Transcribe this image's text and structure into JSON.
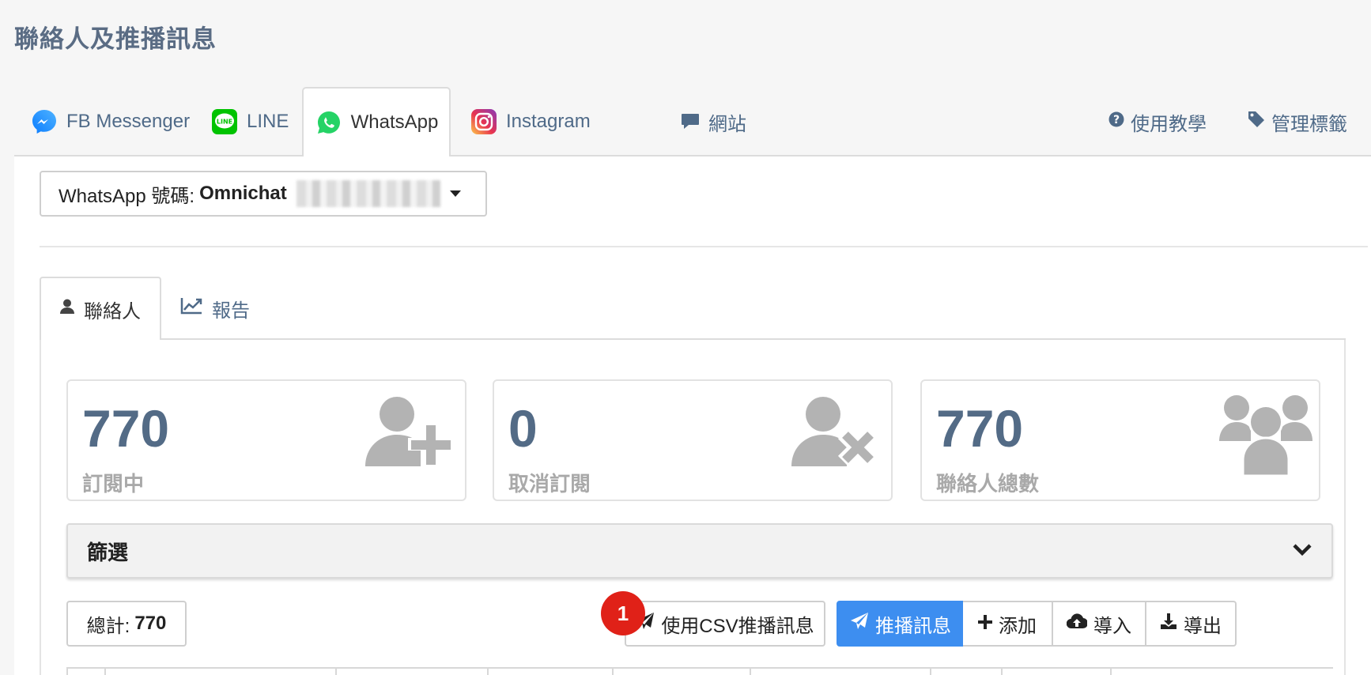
{
  "page": {
    "title": "聯絡人及推播訊息"
  },
  "top_tabs": [
    {
      "label": "FB Messenger",
      "icon": "messenger-icon"
    },
    {
      "label": "LINE",
      "icon": "line-icon"
    },
    {
      "label": "WhatsApp",
      "icon": "whatsapp-icon",
      "active": true
    },
    {
      "label": "Instagram",
      "icon": "instagram-icon"
    },
    {
      "label": "網站",
      "icon": "chat-bubble-icon"
    }
  ],
  "right_links": {
    "tutorial": "使用教學",
    "manage_tags": "管理標籤"
  },
  "whatsapp_select": {
    "prefix": "WhatsApp 號碼:",
    "name": "Omnichat"
  },
  "sub_tabs": {
    "contacts": "聯絡人",
    "report": "報告"
  },
  "stats": [
    {
      "value": "770",
      "label": "訂閱中",
      "icon": "user-plus-icon"
    },
    {
      "value": "0",
      "label": "取消訂閱",
      "icon": "user-times-icon"
    },
    {
      "value": "770",
      "label": "聯絡人總數",
      "icon": "users-icon"
    }
  ],
  "filter": {
    "title": "篩選"
  },
  "toolbar": {
    "total_label": "總計:",
    "total_value": "770",
    "badge": "1",
    "csv_broadcast": "使用CSV推播訊息",
    "broadcast": "推播訊息",
    "add": "添加",
    "import": "導入",
    "export": "導出"
  },
  "colors": {
    "primary": "#3d8ef0",
    "title": "#5a6c84",
    "stat_number": "#536b86",
    "badge": "#e02118",
    "whatsapp": "#25d366",
    "line": "#00c300",
    "messenger": "#0a7cff"
  }
}
